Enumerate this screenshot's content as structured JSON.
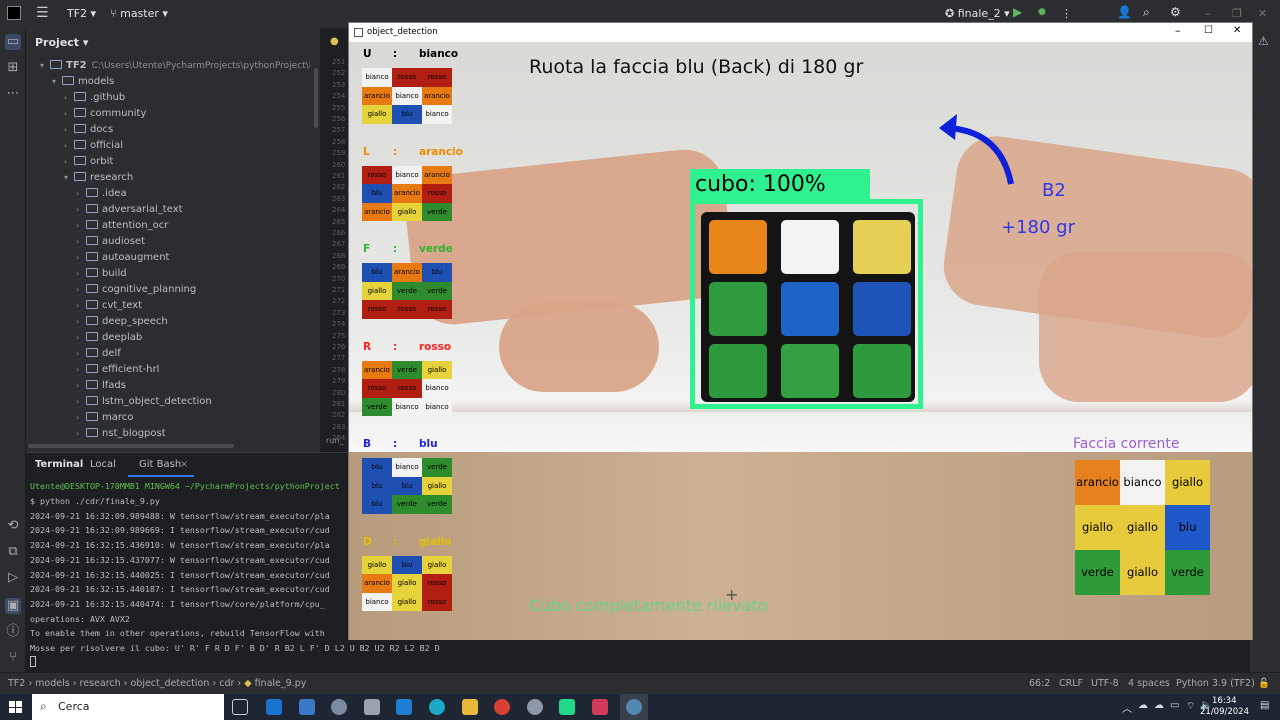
{
  "ide": {
    "project_name": "TF2",
    "branch": "master",
    "run_config": "finale_2",
    "project_label": "Project",
    "root_path": "C:\\Users\\Utente\\PycharmProjects\\pythonProject\\NNFS\\",
    "tree": [
      "TF2",
      "models",
      ".github",
      "community",
      "docs",
      "official",
      "orbit",
      "research",
      ".idea",
      "adversarial_text",
      "attention_ocr",
      "audioset",
      "autoaugment",
      "build",
      "cognitive_planning",
      "cvt_text",
      "deep_speech",
      "deeplab",
      "delf",
      "efficient-hrl",
      "lfads",
      "lstm_object_detection",
      "marco",
      "nst_blogpost"
    ],
    "gutter_lines": [
      "251",
      "252",
      "253",
      "254",
      "255",
      "256",
      "257",
      "258",
      "259",
      "260",
      "261",
      "262",
      "263",
      "264",
      "265",
      "266",
      "267",
      "268",
      "269",
      "270",
      "271",
      "272",
      "273",
      "274",
      "275",
      "276",
      "277",
      "278",
      "279",
      "280",
      "281",
      "282",
      "283",
      "284"
    ],
    "run_label": "run_"
  },
  "terminal": {
    "tabs": [
      "Terminal",
      "Local",
      "Git Bash"
    ],
    "prompt": "Utente@DESKTOP-170MMB1 MINGW64 ~/PycharmProjects/pythonProject",
    "lines": [
      "$ python ./cdr/finale_9.py",
      "2024-09-21 16:32:09.989488: W tensorflow/stream_executor/pla",
      "2024-09-21 16:32:09.989669: I tensorflow/stream_executor/cud",
      "2024-09-21 16:32:15.436910: W tensorflow/stream_executor/pla",
      "2024-09-21 16:32:15.437077: W tensorflow/stream_executor/cud",
      "2024-09-21 16:32:15.440025: I tensorflow/stream_executor/cud",
      "2024-09-21 16:32:15.440187: I tensorflow/stream_executor/cud",
      "2024-09-21 16:32:15.440474: I tensorflow/core/platform/cpu_",
      "operations:  AVX AVX2",
      "To enable them in other operations, rebuild TensorFlow with",
      "Mosse per risolvere il cubo: U' R' F R D F' B D' R B2 L F' D L2 U B2 U2 R2 L2 B2 D"
    ]
  },
  "statusbar": {
    "breadcrumb": [
      "TF2",
      "models",
      "research",
      "object_detection",
      "cdr",
      "finale_9.py"
    ],
    "position": "66:2",
    "line_sep": "CRLF",
    "encoding": "UTF-8",
    "indent": "4 spaces",
    "interpreter": "Python 3.9 (TF2)"
  },
  "taskbar": {
    "search_placeholder": "Cerca",
    "time": "16:34",
    "date": "21/09/2024"
  },
  "cv": {
    "window_title": "object_detection",
    "instruction": "Ruota la faccia blu (Back) di 180 gr",
    "detection_label": "cubo: 100%",
    "move_code": "B2",
    "move_angle": "+180 gr",
    "status": "Cubo completamente rilevato",
    "current_face_title": "Faccia corrente",
    "faces": [
      {
        "letter": "U",
        "name": "bianco",
        "color": "#000000",
        "cells": [
          [
            "bianco",
            "rosso",
            "rosso"
          ],
          [
            "arancio",
            "bianco",
            "arancio"
          ],
          [
            "giallo",
            "blu",
            "bianco"
          ]
        ]
      },
      {
        "letter": "L",
        "name": "arancio",
        "color": "#f08c00",
        "cells": [
          [
            "rosso",
            "bianco",
            "arancio"
          ],
          [
            "blu",
            "arancio",
            "rosso"
          ],
          [
            "arancio",
            "giallo",
            "verde"
          ]
        ]
      },
      {
        "letter": "F",
        "name": "verde",
        "color": "#2fb52f",
        "cells": [
          [
            "blu",
            "arancio",
            "blu"
          ],
          [
            "giallo",
            "verde",
            "verde"
          ],
          [
            "rosso",
            "rosso",
            "rosso"
          ]
        ]
      },
      {
        "letter": "R",
        "name": "rosso",
        "color": "#ff2020",
        "cells": [
          [
            "arancio",
            "verde",
            "giallo"
          ],
          [
            "rosso",
            "rosso",
            "bianco"
          ],
          [
            "verde",
            "bianco",
            "bianco"
          ]
        ]
      },
      {
        "letter": "B",
        "name": "blu",
        "color": "#2020e0",
        "cells": [
          [
            "blu",
            "bianco",
            "verde"
          ],
          [
            "blu",
            "blu",
            "giallo"
          ],
          [
            "blu",
            "verde",
            "verde"
          ]
        ]
      },
      {
        "letter": "D",
        "name": "giallo",
        "color": "#e0c000",
        "cells": [
          [
            "giallo",
            "blu",
            "giallo"
          ],
          [
            "arancio",
            "giallo",
            "rosso"
          ],
          [
            "bianco",
            "giallo",
            "rosso"
          ]
        ]
      }
    ],
    "current_face": [
      [
        "arancio",
        "bianco",
        "giallo"
      ],
      [
        "giallo",
        "giallo",
        "blu"
      ],
      [
        "verde",
        "giallo",
        "verde"
      ]
    ],
    "live_cube": [
      [
        "#e8861a",
        "#f2f4f4",
        "#e6cf55"
      ],
      [
        "#2e9b3e",
        "#1e63c8",
        "#1e54b8"
      ],
      [
        "#2c9a3c",
        "#33a043",
        "#2e9a3e"
      ]
    ],
    "palette": {
      "bianco": "#f2f2f2",
      "rosso": "#b01f12",
      "arancio": "#e87a14",
      "giallo": "#e6d23a",
      "verde": "#2e8b2e",
      "blu": "#1f4fb0"
    },
    "current_palette": {
      "arancio": "#e7811d",
      "bianco": "#f2f2f2",
      "giallo": "#e8cb3c",
      "blu": "#1f58c8",
      "verde": "#2f9a3a"
    }
  }
}
